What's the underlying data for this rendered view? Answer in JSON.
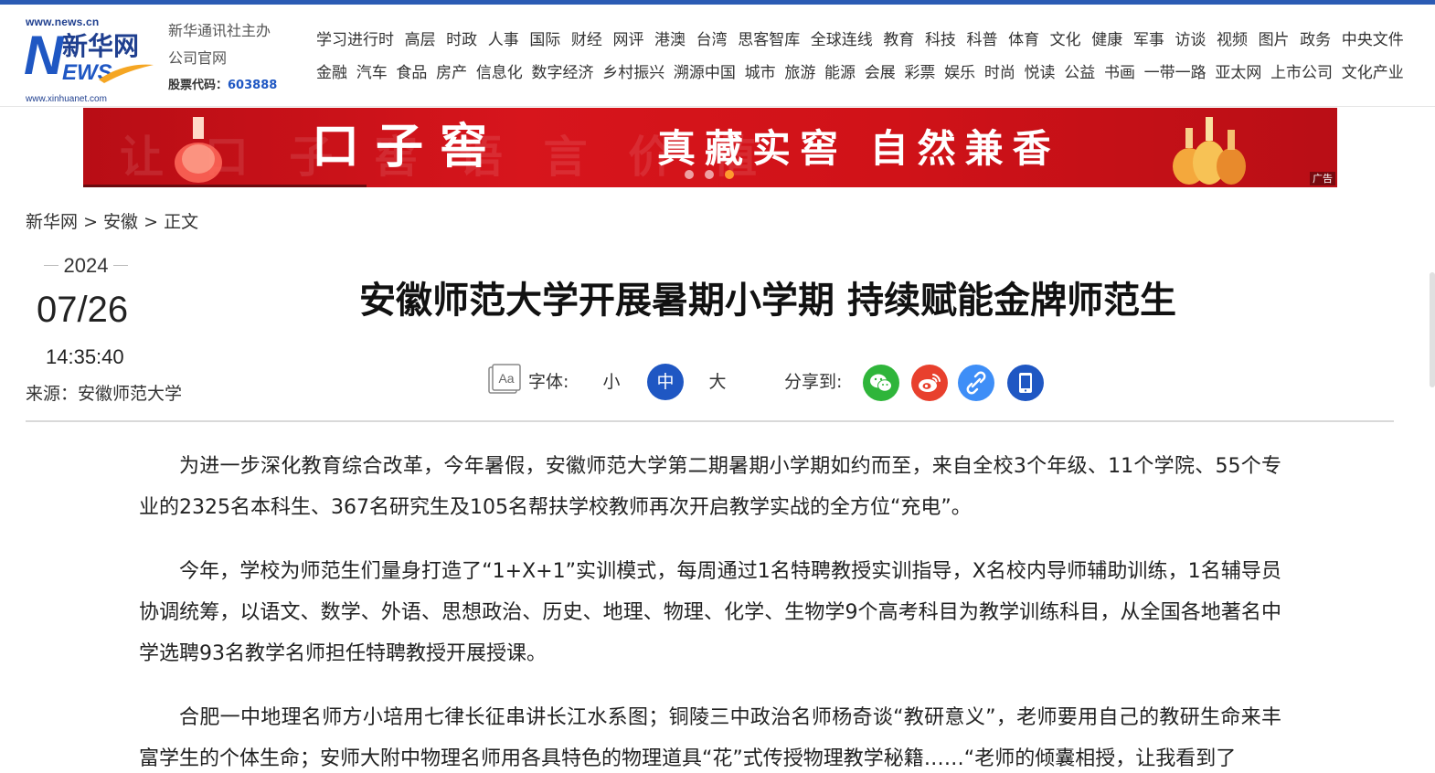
{
  "site": {
    "logo_url_top": "www.news.cn",
    "logo_letter": "N",
    "logo_cn": "新华网",
    "logo_ews": "EWS",
    "logo_url_bottom": "www.xinhuanet.com",
    "sponsor_line1": "新华通讯社主办",
    "sponsor_line2": "公司官网",
    "stock_label": "股票代码：",
    "stock_code": "603888",
    "brand_color": "#1f57c3"
  },
  "nav": {
    "row1": [
      "学习进行时",
      "高层",
      "时政",
      "人事",
      "国际",
      "财经",
      "网评",
      "港澳",
      "台湾",
      "思客智库",
      "全球连线",
      "教育",
      "科技",
      "科普",
      "体育",
      "文化",
      "健康",
      "军事",
      "访谈",
      "视频",
      "图片",
      "政务",
      "中央文件"
    ],
    "row2": [
      "金融",
      "汽车",
      "食品",
      "房产",
      "信息化",
      "数字经济",
      "乡村振兴",
      "溯源中国",
      "城市",
      "旅游",
      "能源",
      "会展",
      "彩票",
      "娱乐",
      "时尚",
      "悦读",
      "公益",
      "书画",
      "一带一路",
      "亚太网",
      "上市公司",
      "文化产业"
    ]
  },
  "banner": {
    "brand": "口子窖",
    "slogan": "真藏实窖 自然兼香",
    "ad_label": "广告",
    "bg_color": "#d7151c",
    "active_dot_color": "#ff9a2e",
    "slides": 3,
    "active_slide": 3
  },
  "breadcrumb": {
    "home": "新华网",
    "sep": ">",
    "section": "安徽",
    "current": "正文"
  },
  "article_meta": {
    "year": "2024",
    "month_day": "07/26",
    "time": "14:35:40",
    "source": "来源：安徽师范大学"
  },
  "article": {
    "title": "安徽师范大学开展暑期小学期 持续赋能金牌师范生",
    "paragraphs": [
      "为进一步深化教育综合改革，今年暑假，安徽师范大学第二期暑期小学期如约而至，来自全校3个年级、11个学院、55个专业的2325名本科生、367名研究生及105名帮扶学校教师再次开启教学实战的全方位“充电”。",
      "今年，学校为师范生们量身打造了“1+X+1”实训模式，每周通过1名特聘教授实训指导，X名校内导师辅助训练，1名辅导员协调统筹，以语文、数学、外语、思想政治、历史、地理、物理、化学、生物学9个高考科目为教学训练科目，从全国各地著名中学选聘93名教学名师担任特聘教授开展授课。",
      "合肥一中地理名师方小培用七律长征串讲长江水系图；铜陵三中政治名师杨奇谈“教研意义”，老师要用自己的教研生命来丰富学生的个体生命；安师大附中物理名师用各具特色的物理道具“花”式传授物理教学秘籍……“老师的倾囊相授，让我看到了"
    ]
  },
  "toolbar": {
    "font_label": "字体:",
    "font_icon_text": "Aa",
    "size_small": "小",
    "size_medium": "中",
    "size_large": "大",
    "selected_size": "中",
    "share_label": "分享到:",
    "share_targets": [
      "wechat-icon",
      "weibo-icon",
      "link-icon",
      "mobile-icon"
    ]
  }
}
